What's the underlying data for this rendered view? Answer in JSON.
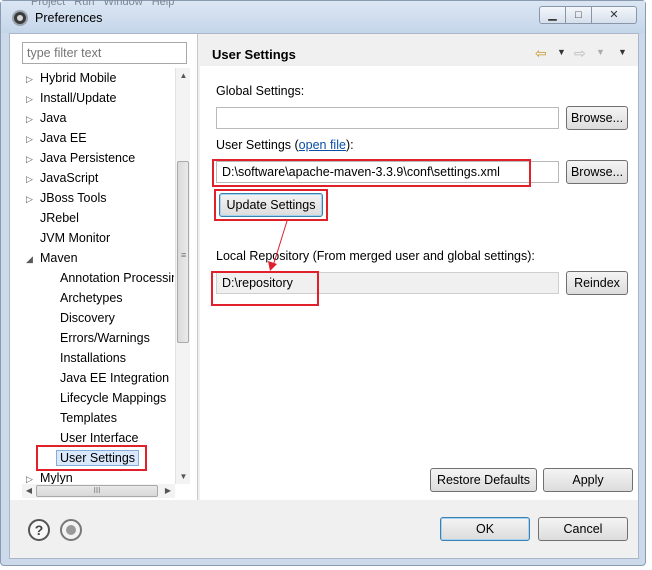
{
  "window": {
    "title": "Preferences",
    "menu_ghost": "Project  Run  Window  Help",
    "minimize_glyph": "▁",
    "maximize_glyph": "□",
    "close_glyph": "✕"
  },
  "filter": {
    "placeholder": "type filter text"
  },
  "tree": {
    "items": [
      {
        "label": "Hybrid Mobile",
        "expander": "▷"
      },
      {
        "label": "Install/Update",
        "expander": "▷"
      },
      {
        "label": "Java",
        "expander": "▷"
      },
      {
        "label": "Java EE",
        "expander": "▷"
      },
      {
        "label": "Java Persistence",
        "expander": "▷"
      },
      {
        "label": "JavaScript",
        "expander": "▷"
      },
      {
        "label": "JBoss Tools",
        "expander": "▷"
      },
      {
        "label": "JRebel",
        "expander": ""
      },
      {
        "label": "JVM Monitor",
        "expander": ""
      },
      {
        "label": "Maven",
        "expander": "◢"
      },
      {
        "label": "Annotation Processing"
      },
      {
        "label": "Archetypes"
      },
      {
        "label": "Discovery"
      },
      {
        "label": "Errors/Warnings"
      },
      {
        "label": "Installations"
      },
      {
        "label": "Java EE Integration"
      },
      {
        "label": "Lifecycle Mappings"
      },
      {
        "label": "Templates"
      },
      {
        "label": "User Interface"
      },
      {
        "label": "User Settings"
      },
      {
        "label": "Mylyn",
        "expander": "▷"
      }
    ],
    "selected": "User Settings"
  },
  "scroll": {
    "v_grip": "≡",
    "h_grip": "III",
    "up": "▲",
    "down": "▼",
    "left": "◀",
    "right": "▶"
  },
  "page": {
    "title": "User Settings",
    "back_glyph": "⇦",
    "forward_glyph": "⇨",
    "dropdown_glyph": "▼",
    "global_settings_label": "Global Settings:",
    "global_settings_value": "",
    "user_settings_label_prefix": "User Settings (",
    "user_settings_link": "open file",
    "user_settings_label_suffix": "):",
    "user_settings_value": "D:\\software\\apache-maven-3.3.9\\conf\\settings.xml",
    "browse_label": "Browse...",
    "update_settings_label": "Update Settings",
    "local_repo_label": "Local Repository (From merged user and global settings):",
    "local_repo_value": "D:\\repository",
    "reindex_label": "Reindex",
    "restore_defaults_label": "Restore Defaults",
    "apply_label": "Apply"
  },
  "footer": {
    "help_glyph": "?",
    "ok_label": "OK",
    "cancel_label": "Cancel"
  },
  "colors": {
    "highlight": "#e0202a",
    "link": "#0b4ea8",
    "selection": "#d9e8fb"
  }
}
